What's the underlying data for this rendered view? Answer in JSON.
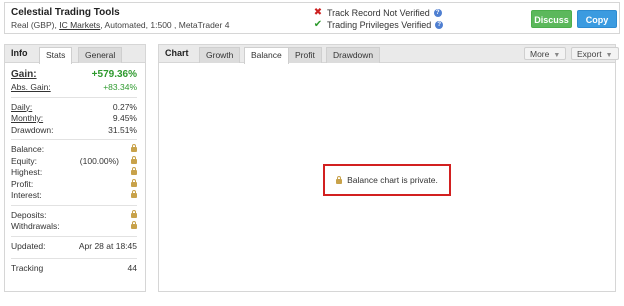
{
  "header": {
    "title": "Celestial Trading Tools",
    "account_prefix": "Real (GBP),",
    "broker": "IC Markets",
    "account_suffix": ", Automated, 1:500 , MetaTrader 4",
    "track_record": "Track Record Not Verified",
    "trading_privileges": "Trading Privileges Verified",
    "discuss_label": "Discuss",
    "copy_label": "Copy"
  },
  "info": {
    "title": "Info",
    "tabs": [
      "Stats",
      "General"
    ],
    "gain": {
      "label": "Gain:",
      "value": "+579.36%"
    },
    "abs_gain": {
      "label": "Abs. Gain:",
      "value": "+83.34%"
    },
    "daily": {
      "label": "Daily:",
      "value": "0.27%"
    },
    "monthly": {
      "label": "Monthly:",
      "value": "9.45%"
    },
    "drawdown": {
      "label": "Drawdown:",
      "value": "31.51%"
    },
    "balance": {
      "label": "Balance:"
    },
    "equity": {
      "label": "Equity:",
      "pct": "(100.00%)"
    },
    "highest": {
      "label": "Highest:"
    },
    "profit": {
      "label": "Profit:"
    },
    "interest": {
      "label": "Interest:"
    },
    "deposits": {
      "label": "Deposits:"
    },
    "withdrawals": {
      "label": "Withdrawals:"
    },
    "updated": {
      "label": "Updated:",
      "value": "Apr 28 at 18:45"
    },
    "tracking": {
      "label": "Tracking",
      "value": "44"
    }
  },
  "chart": {
    "title": "Chart",
    "tabs": [
      "Growth",
      "Balance",
      "Profit",
      "Drawdown"
    ],
    "active_tab": "Balance",
    "more_label": "More",
    "export_label": "Export",
    "private_message": "Balance chart is private."
  },
  "colors": {
    "green": "#2e9a2e",
    "blue_button": "#3b9be0",
    "green_button": "#5cb85c",
    "error_red": "#d22020"
  }
}
